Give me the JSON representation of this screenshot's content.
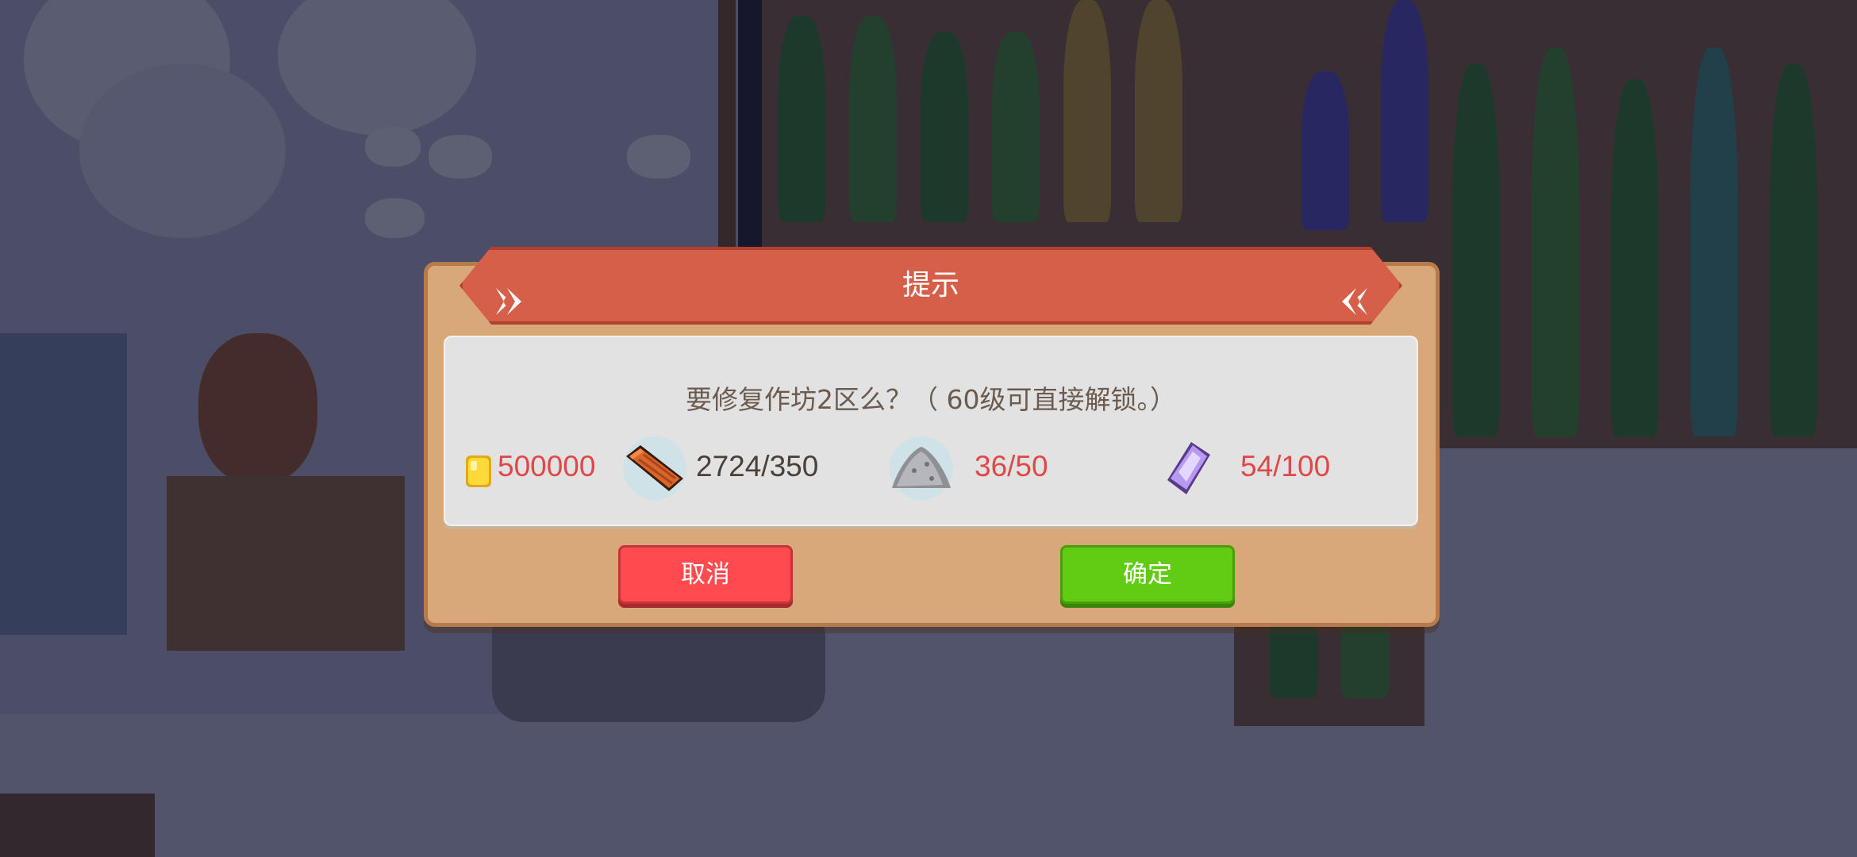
{
  "dialog": {
    "title": "提示",
    "message": "要修复作坊2区么？（ 60级可直接解锁。）",
    "costs": [
      {
        "icon": "gold-coin-icon",
        "text": "500000",
        "sufficient": false
      },
      {
        "icon": "wood-plank-icon",
        "text": "2724/350",
        "sufficient": true
      },
      {
        "icon": "stone-pile-icon",
        "text": "36/50",
        "sufficient": false
      },
      {
        "icon": "purple-crystal-icon",
        "text": "54/100",
        "sufficient": false
      }
    ],
    "cancel_label": "取消",
    "confirm_label": "确定"
  },
  "colors": {
    "header": "#d65f4a",
    "panel": "#d9a878",
    "insufficient_text": "#e04848",
    "cancel_button": "#ff4a4f",
    "confirm_button": "#62cc14"
  }
}
